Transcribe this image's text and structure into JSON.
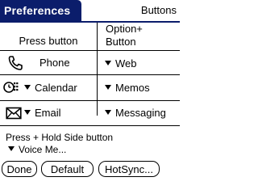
{
  "header": {
    "title": "Preferences",
    "section": "Buttons"
  },
  "columns": {
    "press_button": "Press button",
    "option_button": "Option+\nButton"
  },
  "rows": [
    {
      "icon": "phone-icon",
      "press_label": "Phone",
      "press_has_menu": false,
      "option_label": "Web"
    },
    {
      "icon": "calendar-icon",
      "press_label": "Calendar",
      "press_has_menu": true,
      "option_label": "Memos"
    },
    {
      "icon": "email-icon",
      "press_label": "Email",
      "press_has_menu": true,
      "option_label": "Messaging"
    }
  ],
  "hold": {
    "label": "Press + Hold Side button",
    "value": "Voice Me..."
  },
  "buttons": {
    "done": "Done",
    "default": "Default",
    "hotsync": "HotSync..."
  },
  "colors": {
    "title_bar": "#0b1d6b",
    "text": "#000000",
    "background": "#ffffff"
  }
}
